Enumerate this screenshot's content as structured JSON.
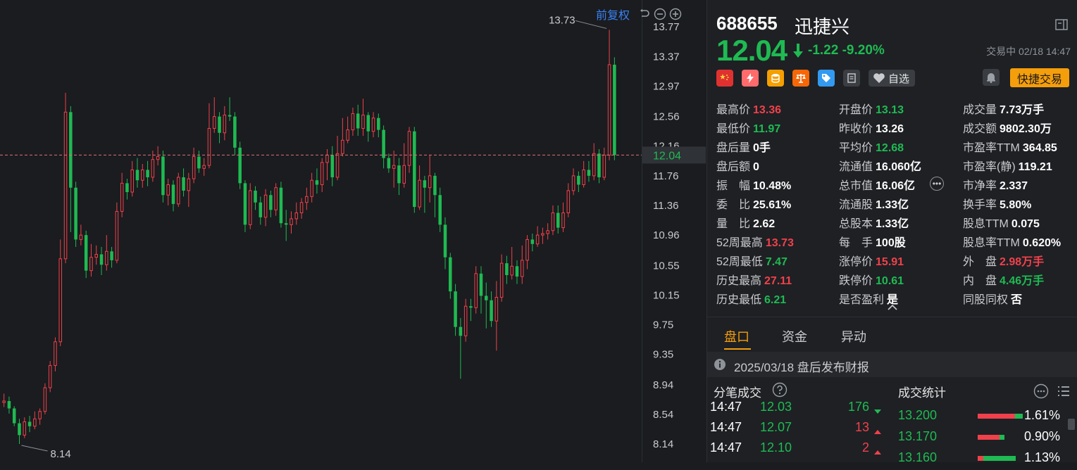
{
  "chart_controls": {
    "adjust_label": "前复权"
  },
  "chart_data": {
    "type": "candlestick",
    "y_ticks": [
      "13.77",
      "13.37",
      "12.97",
      "12.56",
      "12.16",
      "11.76",
      "11.36",
      "10.96",
      "10.55",
      "10.15",
      "9.75",
      "9.35",
      "8.94",
      "8.54",
      "8.14"
    ],
    "ylim": [
      7.96,
      14.0
    ],
    "current_price_label": "12.04",
    "current_price": 12.04,
    "max_label": "13.73",
    "min_label": "8.14",
    "up_color": "#f0414b",
    "down_color": "#1fba52",
    "candles": [
      [
        8.7,
        8.72,
        8.82,
        8.64
      ],
      [
        8.72,
        8.62,
        8.78,
        8.55
      ],
      [
        8.62,
        8.42,
        8.65,
        8.38
      ],
      [
        8.42,
        8.26,
        8.48,
        8.14
      ],
      [
        8.26,
        8.44,
        8.5,
        8.22
      ],
      [
        8.44,
        8.38,
        8.52,
        8.3
      ],
      [
        8.38,
        8.48,
        8.58,
        8.34
      ],
      [
        8.48,
        8.58,
        8.62,
        8.4
      ],
      [
        8.58,
        8.9,
        8.96,
        8.54
      ],
      [
        8.9,
        9.2,
        9.26,
        8.84
      ],
      [
        9.2,
        9.52,
        9.58,
        9.12
      ],
      [
        9.52,
        10.64,
        10.9,
        9.46
      ],
      [
        10.64,
        12.62,
        12.88,
        10.58
      ],
      [
        12.62,
        11.6,
        12.7,
        11.0
      ],
      [
        11.6,
        10.9,
        11.68,
        10.8
      ],
      [
        10.9,
        10.96,
        11.1,
        10.82
      ],
      [
        10.96,
        10.48,
        11.02,
        10.38
      ],
      [
        10.48,
        10.66,
        10.84,
        10.4
      ],
      [
        10.66,
        10.7,
        10.82,
        10.56
      ],
      [
        10.7,
        10.56,
        10.8,
        10.42
      ],
      [
        10.56,
        10.74,
        10.96,
        10.48
      ],
      [
        10.74,
        10.62,
        10.8,
        10.52
      ],
      [
        10.62,
        11.28,
        11.4,
        10.58
      ],
      [
        11.28,
        11.66,
        11.8,
        11.2
      ],
      [
        11.66,
        11.54,
        11.72,
        11.44
      ],
      [
        11.54,
        11.84,
        11.96,
        11.48
      ],
      [
        11.84,
        11.7,
        12.0,
        11.6
      ],
      [
        11.7,
        11.84,
        11.92,
        11.6
      ],
      [
        11.84,
        11.74,
        11.96,
        11.62
      ],
      [
        11.74,
        11.98,
        12.1,
        11.68
      ],
      [
        11.98,
        12.02,
        12.16,
        11.9
      ],
      [
        12.02,
        11.5,
        12.1,
        11.4
      ],
      [
        11.5,
        11.64,
        11.72,
        11.36
      ],
      [
        11.64,
        11.38,
        11.7,
        11.28
      ],
      [
        11.38,
        11.74,
        11.8,
        11.34
      ],
      [
        11.74,
        11.56,
        11.86,
        11.48
      ],
      [
        11.56,
        11.72,
        11.8,
        11.34
      ],
      [
        11.72,
        12.02,
        12.14,
        11.66
      ],
      [
        12.02,
        11.86,
        12.1,
        11.8
      ],
      [
        11.86,
        11.9,
        12.0,
        11.76
      ],
      [
        11.9,
        12.4,
        12.74,
        11.86
      ],
      [
        12.4,
        12.56,
        12.82,
        12.34
      ],
      [
        12.56,
        12.34,
        12.62,
        12.2
      ],
      [
        12.34,
        12.58,
        12.7,
        12.24
      ],
      [
        12.58,
        12.56,
        12.82,
        12.5
      ],
      [
        12.56,
        12.14,
        12.62,
        12.04
      ],
      [
        12.14,
        11.66,
        12.22,
        11.58
      ],
      [
        11.66,
        11.1,
        11.7,
        11.0
      ],
      [
        11.1,
        11.56,
        11.66,
        11.04
      ],
      [
        11.56,
        11.4,
        11.62,
        11.3
      ],
      [
        11.4,
        11.2,
        11.48,
        11.1
      ],
      [
        11.2,
        11.5,
        11.58,
        11.08
      ],
      [
        11.5,
        11.3,
        11.56,
        11.2
      ],
      [
        11.3,
        11.6,
        11.66,
        11.22
      ],
      [
        11.6,
        11.12,
        11.68,
        11.06
      ],
      [
        11.12,
        11.1,
        11.3,
        10.88
      ],
      [
        11.1,
        11.18,
        11.28,
        10.98
      ],
      [
        11.18,
        11.26,
        11.4,
        11.1
      ],
      [
        11.26,
        11.4,
        11.46,
        11.18
      ],
      [
        11.4,
        11.48,
        11.6,
        11.3
      ],
      [
        11.48,
        11.7,
        11.8,
        11.4
      ],
      [
        11.7,
        11.64,
        11.86,
        11.52
      ],
      [
        11.64,
        11.94,
        12.0,
        11.54
      ],
      [
        11.94,
        12.04,
        12.12,
        11.7
      ],
      [
        12.04,
        11.74,
        12.16,
        11.62
      ],
      [
        11.74,
        12.06,
        12.3,
        11.7
      ],
      [
        12.06,
        12.24,
        12.54,
        12.02
      ],
      [
        12.24,
        12.38,
        12.56,
        12.2
      ],
      [
        12.38,
        12.6,
        12.68,
        12.3
      ],
      [
        12.6,
        12.4,
        12.72,
        12.3
      ],
      [
        12.4,
        12.58,
        12.8,
        12.3
      ],
      [
        12.58,
        12.36,
        12.62,
        12.22
      ],
      [
        12.36,
        12.54,
        12.62,
        12.28
      ],
      [
        12.54,
        12.38,
        12.6,
        12.28
      ],
      [
        12.38,
        12.0,
        12.44,
        11.86
      ],
      [
        12.0,
        11.86,
        12.06,
        11.8
      ],
      [
        11.86,
        11.9,
        12.1,
        11.6
      ],
      [
        11.9,
        11.66,
        12.0,
        11.5
      ],
      [
        11.66,
        11.9,
        12.2,
        11.6
      ],
      [
        11.9,
        12.36,
        12.42,
        11.8
      ],
      [
        12.36,
        11.34,
        12.42,
        11.26
      ],
      [
        11.34,
        11.7,
        11.9,
        11.3
      ],
      [
        11.7,
        11.6,
        11.76,
        11.26
      ],
      [
        11.6,
        11.76,
        12.04,
        11.4
      ],
      [
        11.76,
        11.5,
        11.8,
        11.2
      ],
      [
        11.5,
        11.1,
        11.6,
        11.0
      ],
      [
        11.1,
        10.66,
        11.2,
        10.5
      ],
      [
        10.66,
        10.2,
        10.72,
        10.1
      ],
      [
        10.2,
        9.72,
        10.3,
        9.6
      ],
      [
        9.72,
        9.6,
        9.84,
        9.02
      ],
      [
        9.6,
        10.0,
        10.1,
        9.52
      ],
      [
        10.0,
        9.98,
        10.1,
        9.8
      ],
      [
        9.98,
        10.44,
        10.54,
        9.9
      ],
      [
        10.44,
        10.14,
        10.54,
        9.9
      ],
      [
        10.14,
        10.08,
        10.32,
        9.7
      ],
      [
        10.08,
        9.8,
        10.2,
        9.72
      ],
      [
        9.8,
        10.12,
        10.34,
        9.4
      ],
      [
        10.12,
        10.58,
        10.7,
        10.06
      ],
      [
        10.58,
        10.42,
        10.68,
        10.3
      ],
      [
        10.42,
        10.54,
        10.8,
        10.36
      ],
      [
        10.54,
        10.4,
        10.62,
        10.3
      ],
      [
        10.4,
        10.62,
        10.82,
        10.3
      ],
      [
        10.62,
        10.9,
        10.96,
        10.5
      ],
      [
        10.9,
        10.84,
        10.98,
        10.74
      ],
      [
        10.84,
        10.96,
        11.08,
        10.8
      ],
      [
        10.96,
        10.98,
        11.06,
        10.84
      ],
      [
        10.98,
        11.02,
        11.12,
        10.9
      ],
      [
        11.02,
        11.26,
        11.36,
        10.96
      ],
      [
        11.26,
        11.06,
        11.36,
        10.98
      ],
      [
        11.06,
        11.26,
        11.4,
        11.0
      ],
      [
        11.26,
        11.56,
        11.66,
        11.2
      ],
      [
        11.56,
        11.76,
        11.86,
        11.5
      ],
      [
        11.76,
        11.64,
        11.82,
        11.54
      ],
      [
        11.64,
        11.84,
        11.96,
        11.6
      ],
      [
        11.84,
        11.76,
        11.96,
        11.68
      ],
      [
        11.76,
        12.06,
        12.2,
        11.7
      ],
      [
        12.06,
        11.74,
        12.12,
        11.66
      ],
      [
        11.74,
        12.04,
        12.14,
        11.7
      ],
      [
        12.04,
        13.26,
        13.73,
        11.97
      ],
      [
        13.26,
        12.04,
        13.36,
        11.97
      ]
    ]
  },
  "quote": {
    "code": "688655",
    "name": "迅捷兴",
    "price": "12.04",
    "change": "-1.22 -9.20%",
    "status": "交易中 02/18 14:47",
    "watch_label": "自选",
    "quick_trade_label": "快捷交易"
  },
  "stats": {
    "col1": [
      {
        "label": "最高价",
        "value": "13.36",
        "color": "red"
      },
      {
        "label": "最低价",
        "value": "11.97",
        "color": "green"
      },
      {
        "label": "盘后量",
        "value": "0手",
        "color": "white"
      },
      {
        "label": "盘后额",
        "value": "0",
        "color": "white"
      },
      {
        "label": "振　幅",
        "value": "10.48%",
        "color": "white"
      },
      {
        "label": "委　比",
        "value": "25.61%",
        "color": "white"
      },
      {
        "label": "量　比",
        "value": "2.62",
        "color": "white"
      },
      {
        "label": "52周最高",
        "value": "13.73",
        "color": "red"
      },
      {
        "label": "52周最低",
        "value": "7.47",
        "color": "green"
      },
      {
        "label": "历史最高",
        "value": "27.11",
        "color": "red"
      },
      {
        "label": "历史最低",
        "value": "6.21",
        "color": "green"
      }
    ],
    "col2": [
      {
        "label": "开盘价",
        "value": "13.13",
        "color": "green"
      },
      {
        "label": "昨收价",
        "value": "13.26",
        "color": "white"
      },
      {
        "label": "平均价",
        "value": "12.68",
        "color": "green"
      },
      {
        "label": "流通值",
        "value": "16.060亿",
        "color": "white"
      },
      {
        "label": "总市值",
        "value": "16.06亿",
        "color": "white"
      },
      {
        "label": "流通股",
        "value": "1.33亿",
        "color": "white"
      },
      {
        "label": "总股本",
        "value": "1.33亿",
        "color": "white"
      },
      {
        "label": "每　手",
        "value": "100股",
        "color": "white"
      },
      {
        "label": "涨停价",
        "value": "15.91",
        "color": "red"
      },
      {
        "label": "跌停价",
        "value": "10.61",
        "color": "green"
      },
      {
        "label": "是否盈利",
        "value": "是",
        "color": "white"
      }
    ],
    "col3": [
      {
        "label": "成交量",
        "value": "7.73万手",
        "color": "white"
      },
      {
        "label": "成交额",
        "value": "9802.30万",
        "color": "white"
      },
      {
        "label": "市盈率TTM",
        "value": "364.85",
        "color": "white"
      },
      {
        "label": "市盈率(静)",
        "value": "119.21",
        "color": "white"
      },
      {
        "label": "市净率",
        "value": "2.337",
        "color": "white"
      },
      {
        "label": "换手率",
        "value": "5.80%",
        "color": "white"
      },
      {
        "label": "股息TTM",
        "value": "0.075",
        "color": "white"
      },
      {
        "label": "股息率TTM",
        "value": "0.620%",
        "color": "white"
      },
      {
        "label": "外　盘",
        "value": "2.98万手",
        "color": "red"
      },
      {
        "label": "内　盘",
        "value": "4.46万手",
        "color": "green"
      },
      {
        "label": "同股同权",
        "value": "否",
        "color": "white"
      }
    ]
  },
  "tabs": [
    {
      "label": "盘口",
      "active": true
    },
    {
      "label": "资金",
      "active": false
    },
    {
      "label": "异动",
      "active": false
    }
  ],
  "notice": {
    "text": "2025/03/18  盘后发布财报"
  },
  "ticks": {
    "title": "分笔成交",
    "rows": [
      {
        "time": "14:47",
        "price": "12.03",
        "vol": "176",
        "dir": "down"
      },
      {
        "time": "14:47",
        "price": "12.07",
        "vol": "13",
        "dir": "up"
      },
      {
        "time": "14:47",
        "price": "12.10",
        "vol": "2",
        "dir": "up"
      }
    ]
  },
  "trade_stats": {
    "title": "成交统计",
    "rows": [
      {
        "price": "13.200",
        "pct": "1.61%",
        "red": 0.78,
        "green": 0.16
      },
      {
        "price": "13.170",
        "pct": "0.90%",
        "red": 0.46,
        "green": 0.1
      },
      {
        "price": "13.160",
        "pct": "1.13%",
        "red": 0.12,
        "green": 0.68
      }
    ]
  }
}
